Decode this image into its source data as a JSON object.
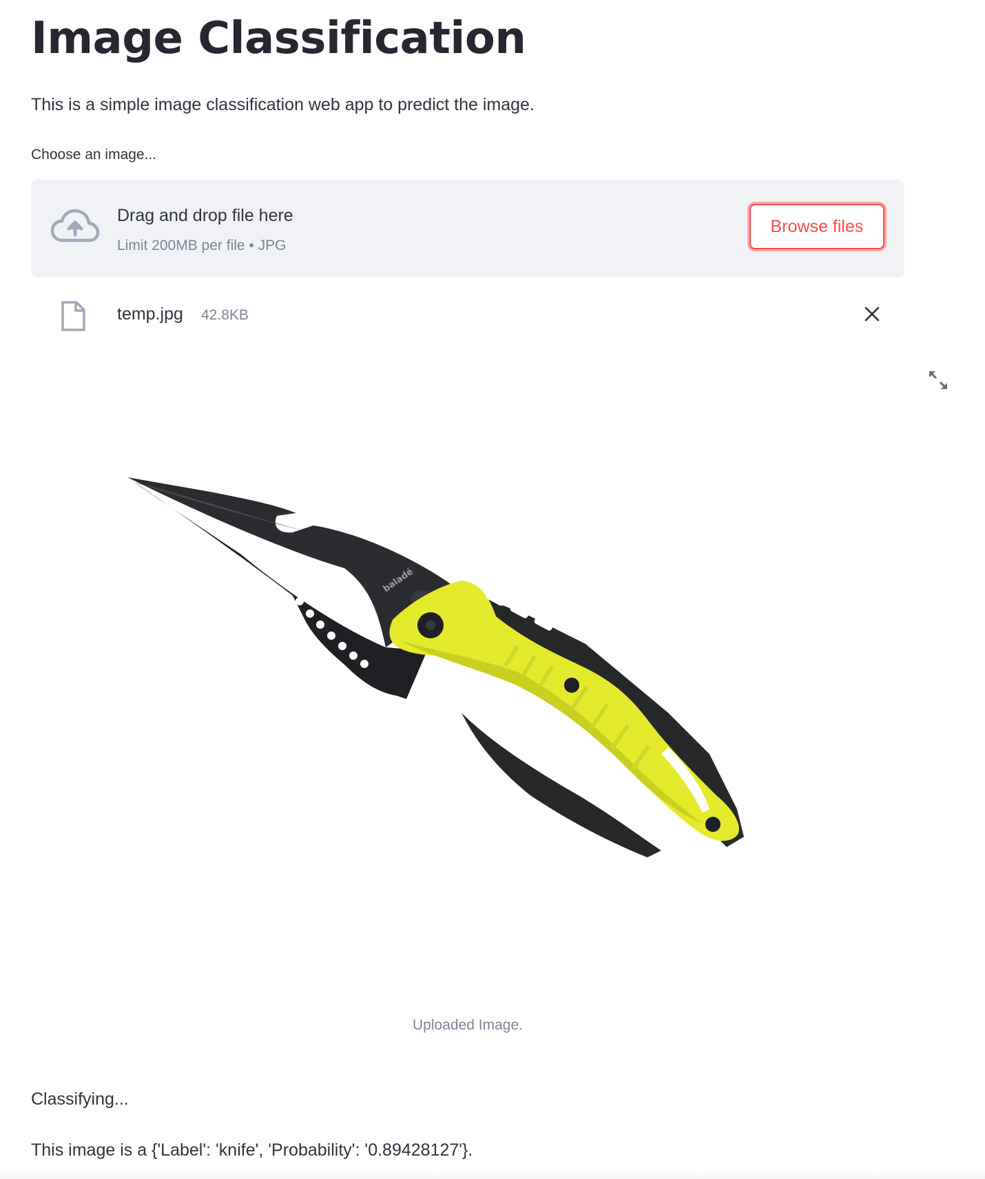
{
  "page": {
    "title": "Image Classification",
    "description": "This is a simple image classification web app to predict the image."
  },
  "uploader": {
    "label": "Choose an image...",
    "dropzone_title": "Drag and drop file here",
    "dropzone_limit": "Limit 200MB per file • JPG",
    "browse_label": "Browse files",
    "icon": "cloud-upload-icon"
  },
  "file": {
    "name": "temp.jpg",
    "size": "42.8KB",
    "icon": "file-icon",
    "remove_icon": "close-icon"
  },
  "image": {
    "caption": "Uploaded Image.",
    "brand_mark": "baladéo",
    "fullscreen_icon": "fullscreen-icon"
  },
  "results": {
    "status": "Classifying...",
    "prediction": "This image is a {'Label': 'knife', 'Probability': '0.89428127'}."
  },
  "colors": {
    "accent": "#ff4b4b",
    "text": "#31333f",
    "muted": "#808495",
    "dropzone_bg": "#f0f2f6",
    "knife_handle": "#e3ea2c",
    "knife_blade": "#2b2c2f"
  }
}
